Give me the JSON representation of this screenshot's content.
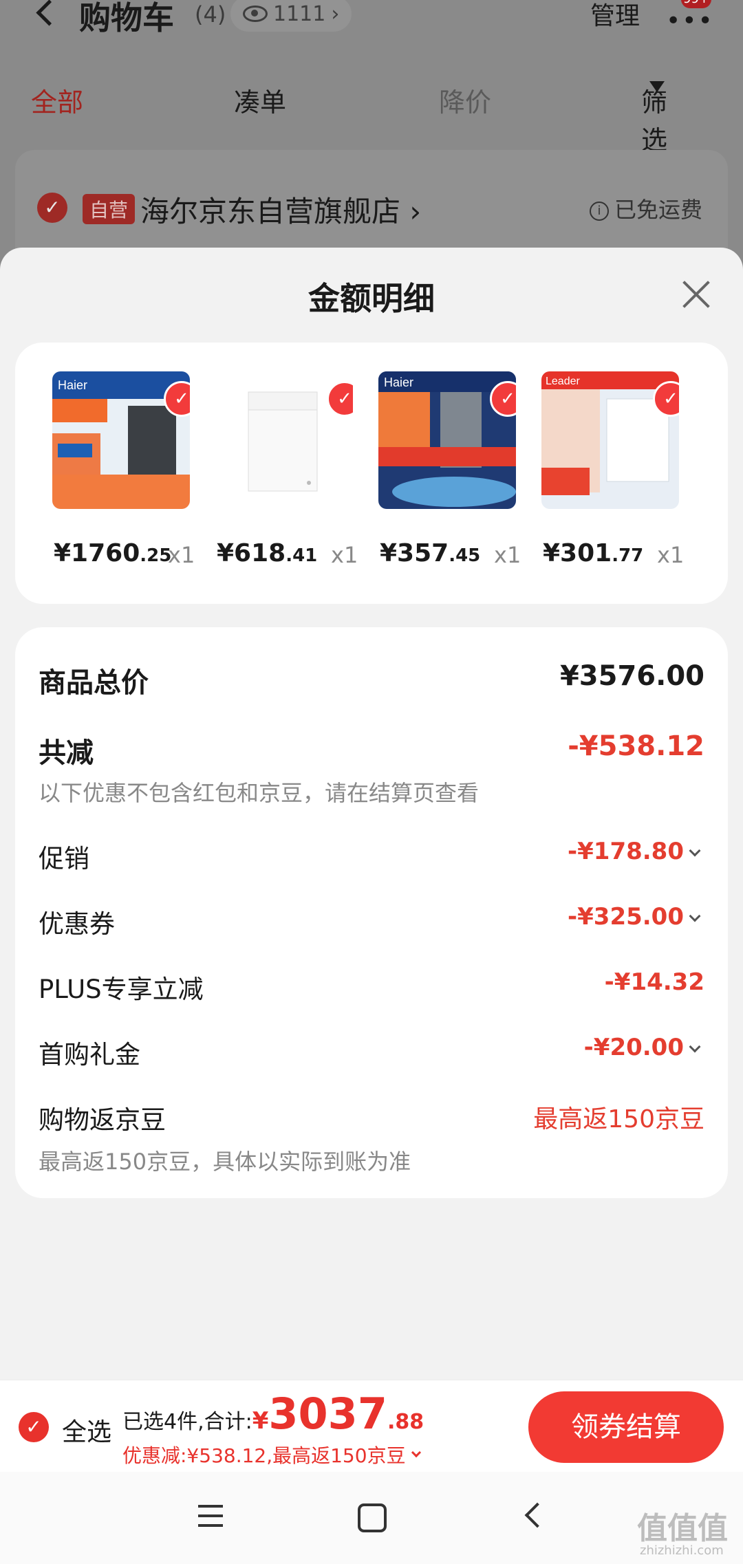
{
  "background_page": {
    "title": "购物车",
    "count": "(4)",
    "views": "1111",
    "manage": "管理",
    "tabs": [
      "全部",
      "凑单",
      "降价",
      "筛选"
    ],
    "store": {
      "tag": "自营",
      "name": "海尔京东自营旗舰店",
      "shipping": "已免运费"
    }
  },
  "sheet": {
    "title": "金额明细",
    "products": [
      {
        "price_int": "¥1760",
        "price_dec": ".25",
        "qty": "x1",
        "image": "Haier water purifier promo"
      },
      {
        "price_int": "¥618",
        "price_dec": ".41",
        "qty": "x1",
        "image": "white chest freezer"
      },
      {
        "price_int": "¥357",
        "price_dec": ".45",
        "qty": "x1",
        "image": "Haier water filter promo"
      },
      {
        "price_int": "¥301",
        "price_dec": ".77",
        "qty": "x1",
        "image": "Leader washing machine promo"
      }
    ],
    "details": {
      "total_label": "商品总价",
      "total_value": "¥3576.00",
      "reduce_label": "共减",
      "reduce_value": "-¥538.12",
      "reduce_note": "以下优惠不包含红包和京豆，请在结算页查看",
      "promo_label": "促销",
      "promo_value": "-¥178.80",
      "coupon_label": "优惠券",
      "coupon_value": "-¥325.00",
      "plus_label": "PLUS专享立减",
      "plus_value": "-¥14.32",
      "firstbuy_label": "首购礼金",
      "firstbuy_value": "-¥20.00",
      "beans_label": "购物返京豆",
      "beans_value": "最高返150京豆",
      "beans_note": "最高返150京豆，具体以实际到账为准"
    }
  },
  "bottom_bar": {
    "select_all": "全选",
    "selected_text": "已选4件,合计:",
    "yen": "¥",
    "total_int": "3037",
    "total_dec": ".88",
    "discount_text": "优惠减:¥538.12,最高返150京豆",
    "checkout_label": "领券结算"
  },
  "watermark": {
    "main": "值值值",
    "sub": "zhizhizhi.com"
  },
  "colors": {
    "accent": "#e43d2f",
    "checkout": "#f23a33"
  }
}
